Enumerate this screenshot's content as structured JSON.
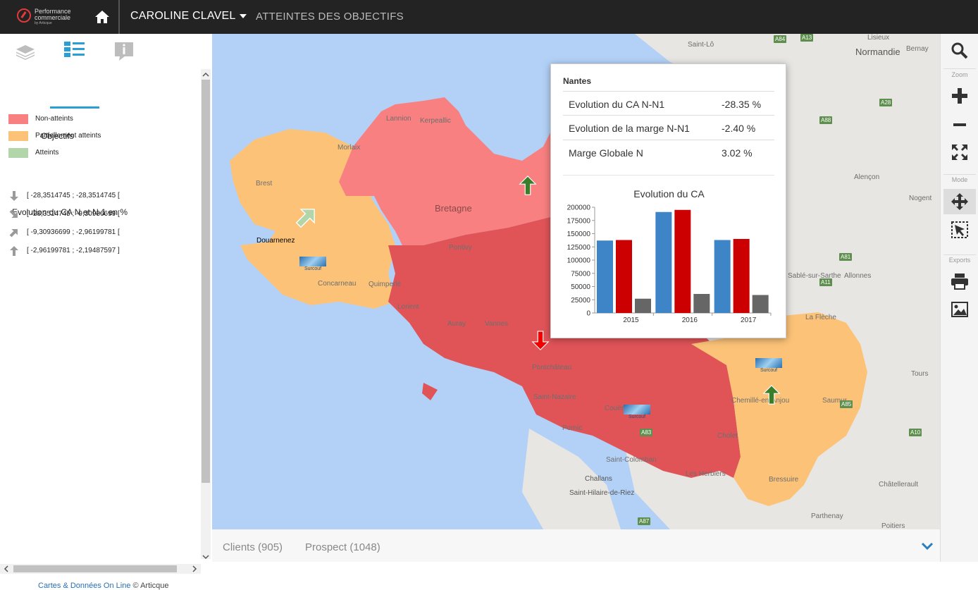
{
  "header": {
    "logo_line1": "Performance",
    "logo_line2": "commerciale",
    "logo_line3": "by Articque",
    "user_name": "CAROLINE CLAVEL",
    "nav_link": "ATTEINTES DES OBJECTIFS"
  },
  "sidebar": {
    "tabs": [
      "layers-icon",
      "legend-list-icon",
      "info-icon"
    ],
    "active_tab": "legend-list-icon",
    "legend_title": "Objectifs",
    "legend_items": [
      {
        "label": "Non-atteints",
        "color": "#f88080"
      },
      {
        "label": "Partiellement atteints",
        "color": "#fcc378"
      },
      {
        "label": "Atteints",
        "color": "#b2d6a9"
      }
    ],
    "evolution_title": "Evolution du CA N et N-1 en %",
    "evolution_items": [
      {
        "icon": "arrow-down-icon",
        "label": "[ -28,3514745 ; -28,3514745 ["
      },
      {
        "icon": "arrow-down-right-icon",
        "label": "[ -28,3514745 ; -9,30936699 ["
      },
      {
        "icon": "arrow-up-right-icon",
        "label": "[ -9,30936699 ; -2,96199781 ["
      },
      {
        "icon": "arrow-up-icon",
        "label": "[ -2,96199781 ; -2,19487597 ]"
      }
    ],
    "credit_link": "Cartes & Données On Line",
    "credit_suffix": " © Articque"
  },
  "bottom_tabs": [
    {
      "label": "Clients (905)"
    },
    {
      "label": "Prospect (1048)"
    }
  ],
  "toolbar": {
    "zoom_label": "Zoom",
    "mode_label": "Mode",
    "exports_label": "Exports"
  },
  "map": {
    "labels": [
      "Saint-Lô",
      "Lisieux",
      "Bernay",
      "Normandie",
      "Alençon",
      "Nogent",
      "Lannion",
      "Kerpeallic",
      "Morlaix",
      "Brest",
      "Douarnenez",
      "Concarneau",
      "Quimperlé",
      "Lorient",
      "Auray",
      "Vannes",
      "Pontivy",
      "Bretagne",
      "Pontchâteau",
      "Saint-Nazaire",
      "Pornic",
      "Saint-Colomban",
      "Challans",
      "Saint-Hilaire-de-Riez",
      "Les Herbiers",
      "Bressuire",
      "Parthenay",
      "Poitiers",
      "Châtellerault",
      "Tours",
      "Saumur",
      "Chemillé-en-Anjou",
      "La Flèche",
      "Allonnes",
      "Sablé-sur-Sarthe",
      "Cholet",
      "Couëron",
      "Surcouf"
    ],
    "roads": [
      "A84",
      "A13",
      "A28",
      "A88",
      "A81",
      "A11",
      "A85",
      "A10",
      "A87",
      "A83"
    ]
  },
  "popup": {
    "title": "Nantes",
    "rows": [
      {
        "label": "Evolution du CA N-N1",
        "value": "-28.35 %"
      },
      {
        "label": "Evolution de la marge N-N1",
        "value": "-2.40 %"
      },
      {
        "label": "Marge Globale N",
        "value": "3.02 %"
      }
    ]
  },
  "chart_data": {
    "type": "bar",
    "title": "Evolution du CA",
    "categories": [
      "2015",
      "2016",
      "2017"
    ],
    "series": [
      {
        "color": "#3d85c6",
        "values": [
          137000,
          191000,
          138000
        ]
      },
      {
        "color": "#cc0000",
        "values": [
          138000,
          195000,
          140000
        ]
      },
      {
        "color": "#666666",
        "values": [
          27000,
          36000,
          34000
        ]
      }
    ],
    "ylim": [
      0,
      200000
    ],
    "yticks": [
      "0",
      "25000",
      "50000",
      "75000",
      "100000",
      "125000",
      "150000",
      "175000",
      "200000"
    ],
    "grid": false,
    "legend": "none"
  }
}
